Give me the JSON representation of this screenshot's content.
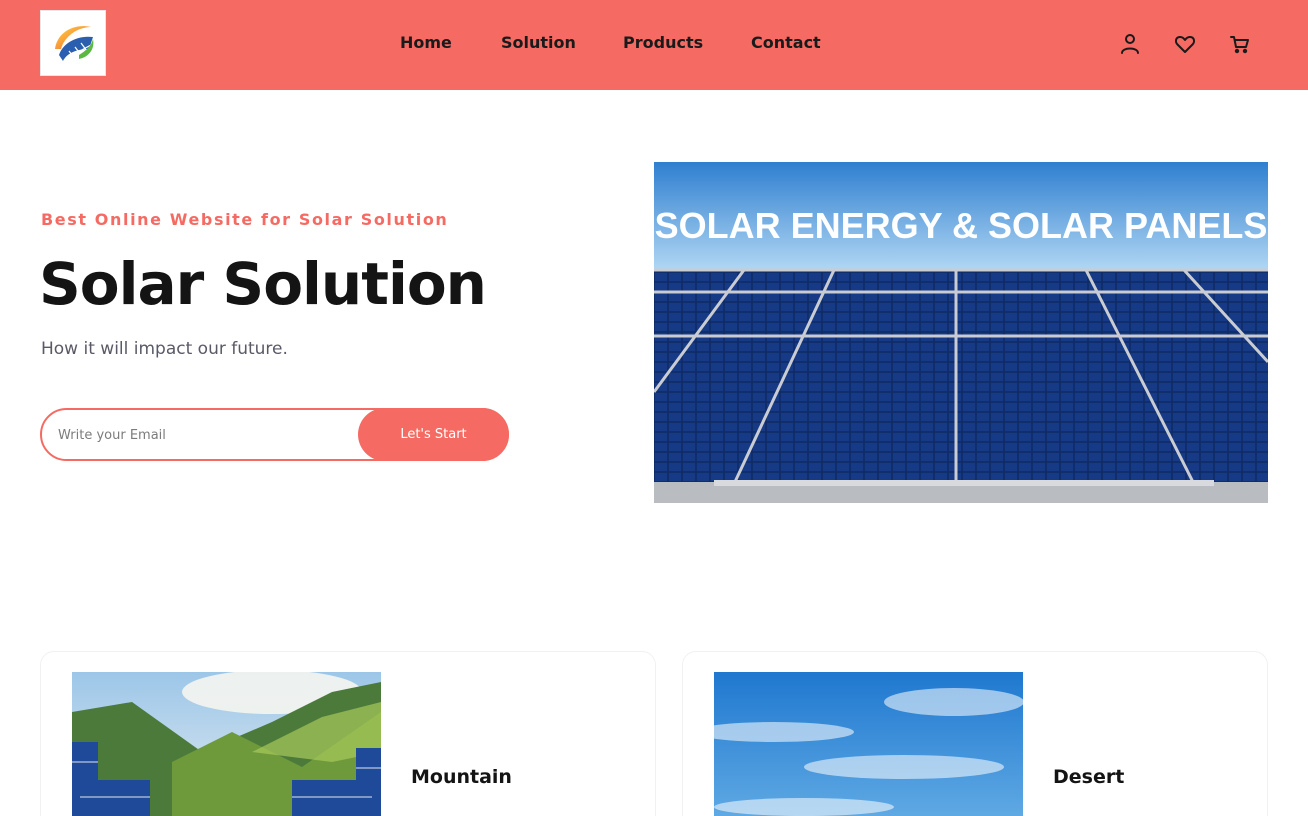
{
  "header": {
    "logo_alt": "Solar logo",
    "nav": [
      {
        "label": "Home"
      },
      {
        "label": "Solution"
      },
      {
        "label": "Products"
      },
      {
        "label": "Contact"
      }
    ],
    "icons": [
      "user-icon",
      "heart-icon",
      "cart-icon"
    ]
  },
  "hero": {
    "tagline": "Best Online Website for Solar Solution",
    "title": "Solar Solution",
    "subtitle": "How it will impact our future.",
    "email_placeholder": "Write your Email",
    "email_value": "",
    "button_label": "Let's Start",
    "image_caption": "SOLAR ENERGY & SOLAR PANELS"
  },
  "cards": [
    {
      "title": "Mountain"
    },
    {
      "title": "Desert"
    }
  ],
  "colors": {
    "accent": "#f56b63",
    "text_dark": "#141414",
    "panel_blue": "#1b3f8a",
    "sky_blue": "#3b8fd6"
  }
}
